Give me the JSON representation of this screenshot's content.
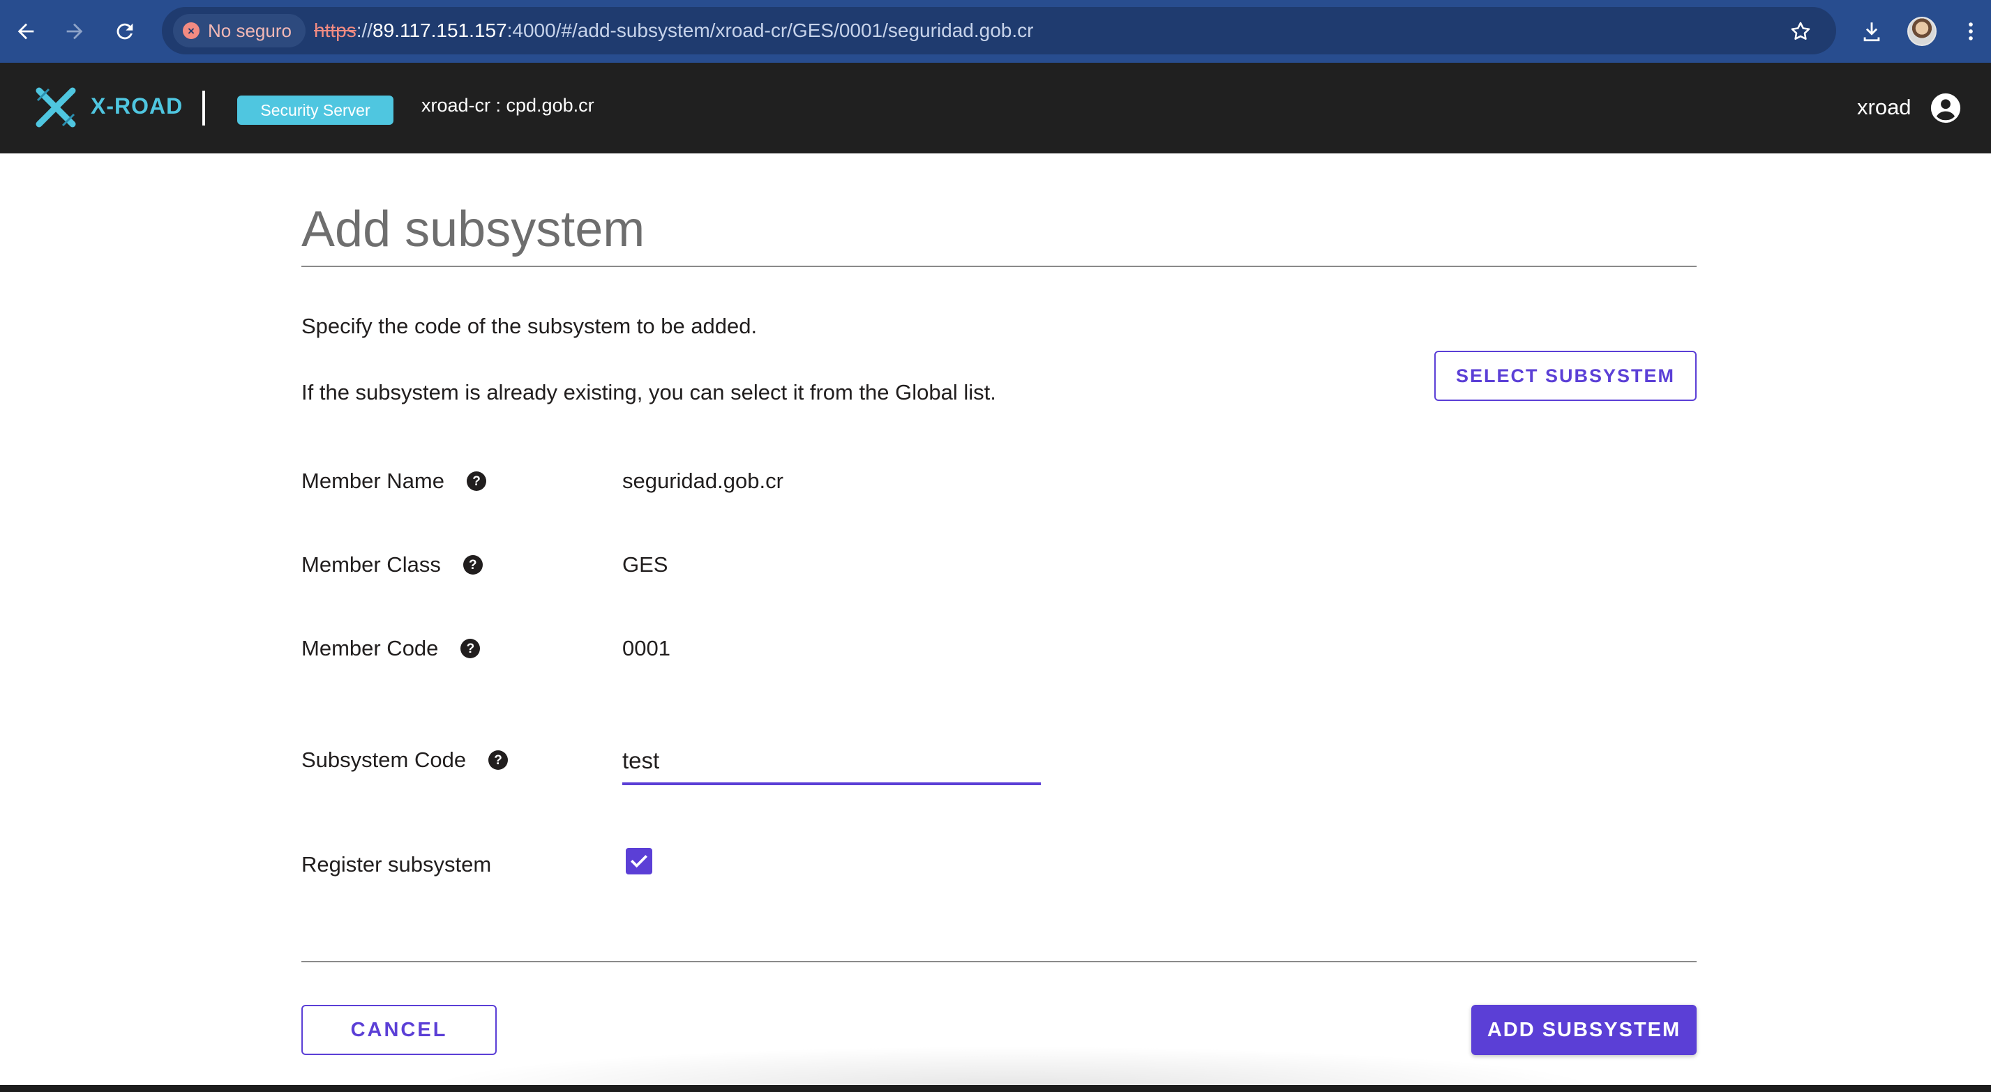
{
  "browser": {
    "security_label": "No seguro",
    "url_scheme": "https",
    "url_sep": "://",
    "url_host": "89.117.151.157",
    "url_rest": ":4000/#/add-subsystem/xroad-cr/GES/0001/seguridad.gob.cr"
  },
  "header": {
    "logo_text": "X-ROAD",
    "badge": "Security Server",
    "server_id": "xroad-cr : cpd.gob.cr",
    "user": "xroad"
  },
  "page": {
    "title": "Add subsystem",
    "desc1": "Specify the code of the subsystem to be added.",
    "desc2": "If the subsystem is already existing, you can select it from the Global list.",
    "select_button": "SELECT SUBSYSTEM"
  },
  "fields": {
    "member_name": {
      "label": "Member Name",
      "value": "seguridad.gob.cr"
    },
    "member_class": {
      "label": "Member Class",
      "value": "GES"
    },
    "member_code": {
      "label": "Member Code",
      "value": "0001"
    },
    "subsystem_code": {
      "label": "Subsystem Code",
      "value": "test"
    },
    "register": {
      "label": "Register subsystem",
      "checked": true
    }
  },
  "actions": {
    "cancel": "CANCEL",
    "add": "ADD SUBSYSTEM"
  },
  "colors": {
    "accent": "#5b3fd6",
    "brand": "#4fc6e0",
    "header_bg": "#202020",
    "chrome_bg": "#284d8f"
  },
  "icons": {
    "back": "arrow-left-icon",
    "forward": "arrow-right-icon",
    "reload": "reload-icon",
    "star": "star-icon",
    "download": "download-icon",
    "menu": "more-vert-icon",
    "user": "account-circle-icon",
    "help": "help-circle-icon",
    "check": "check-icon"
  }
}
